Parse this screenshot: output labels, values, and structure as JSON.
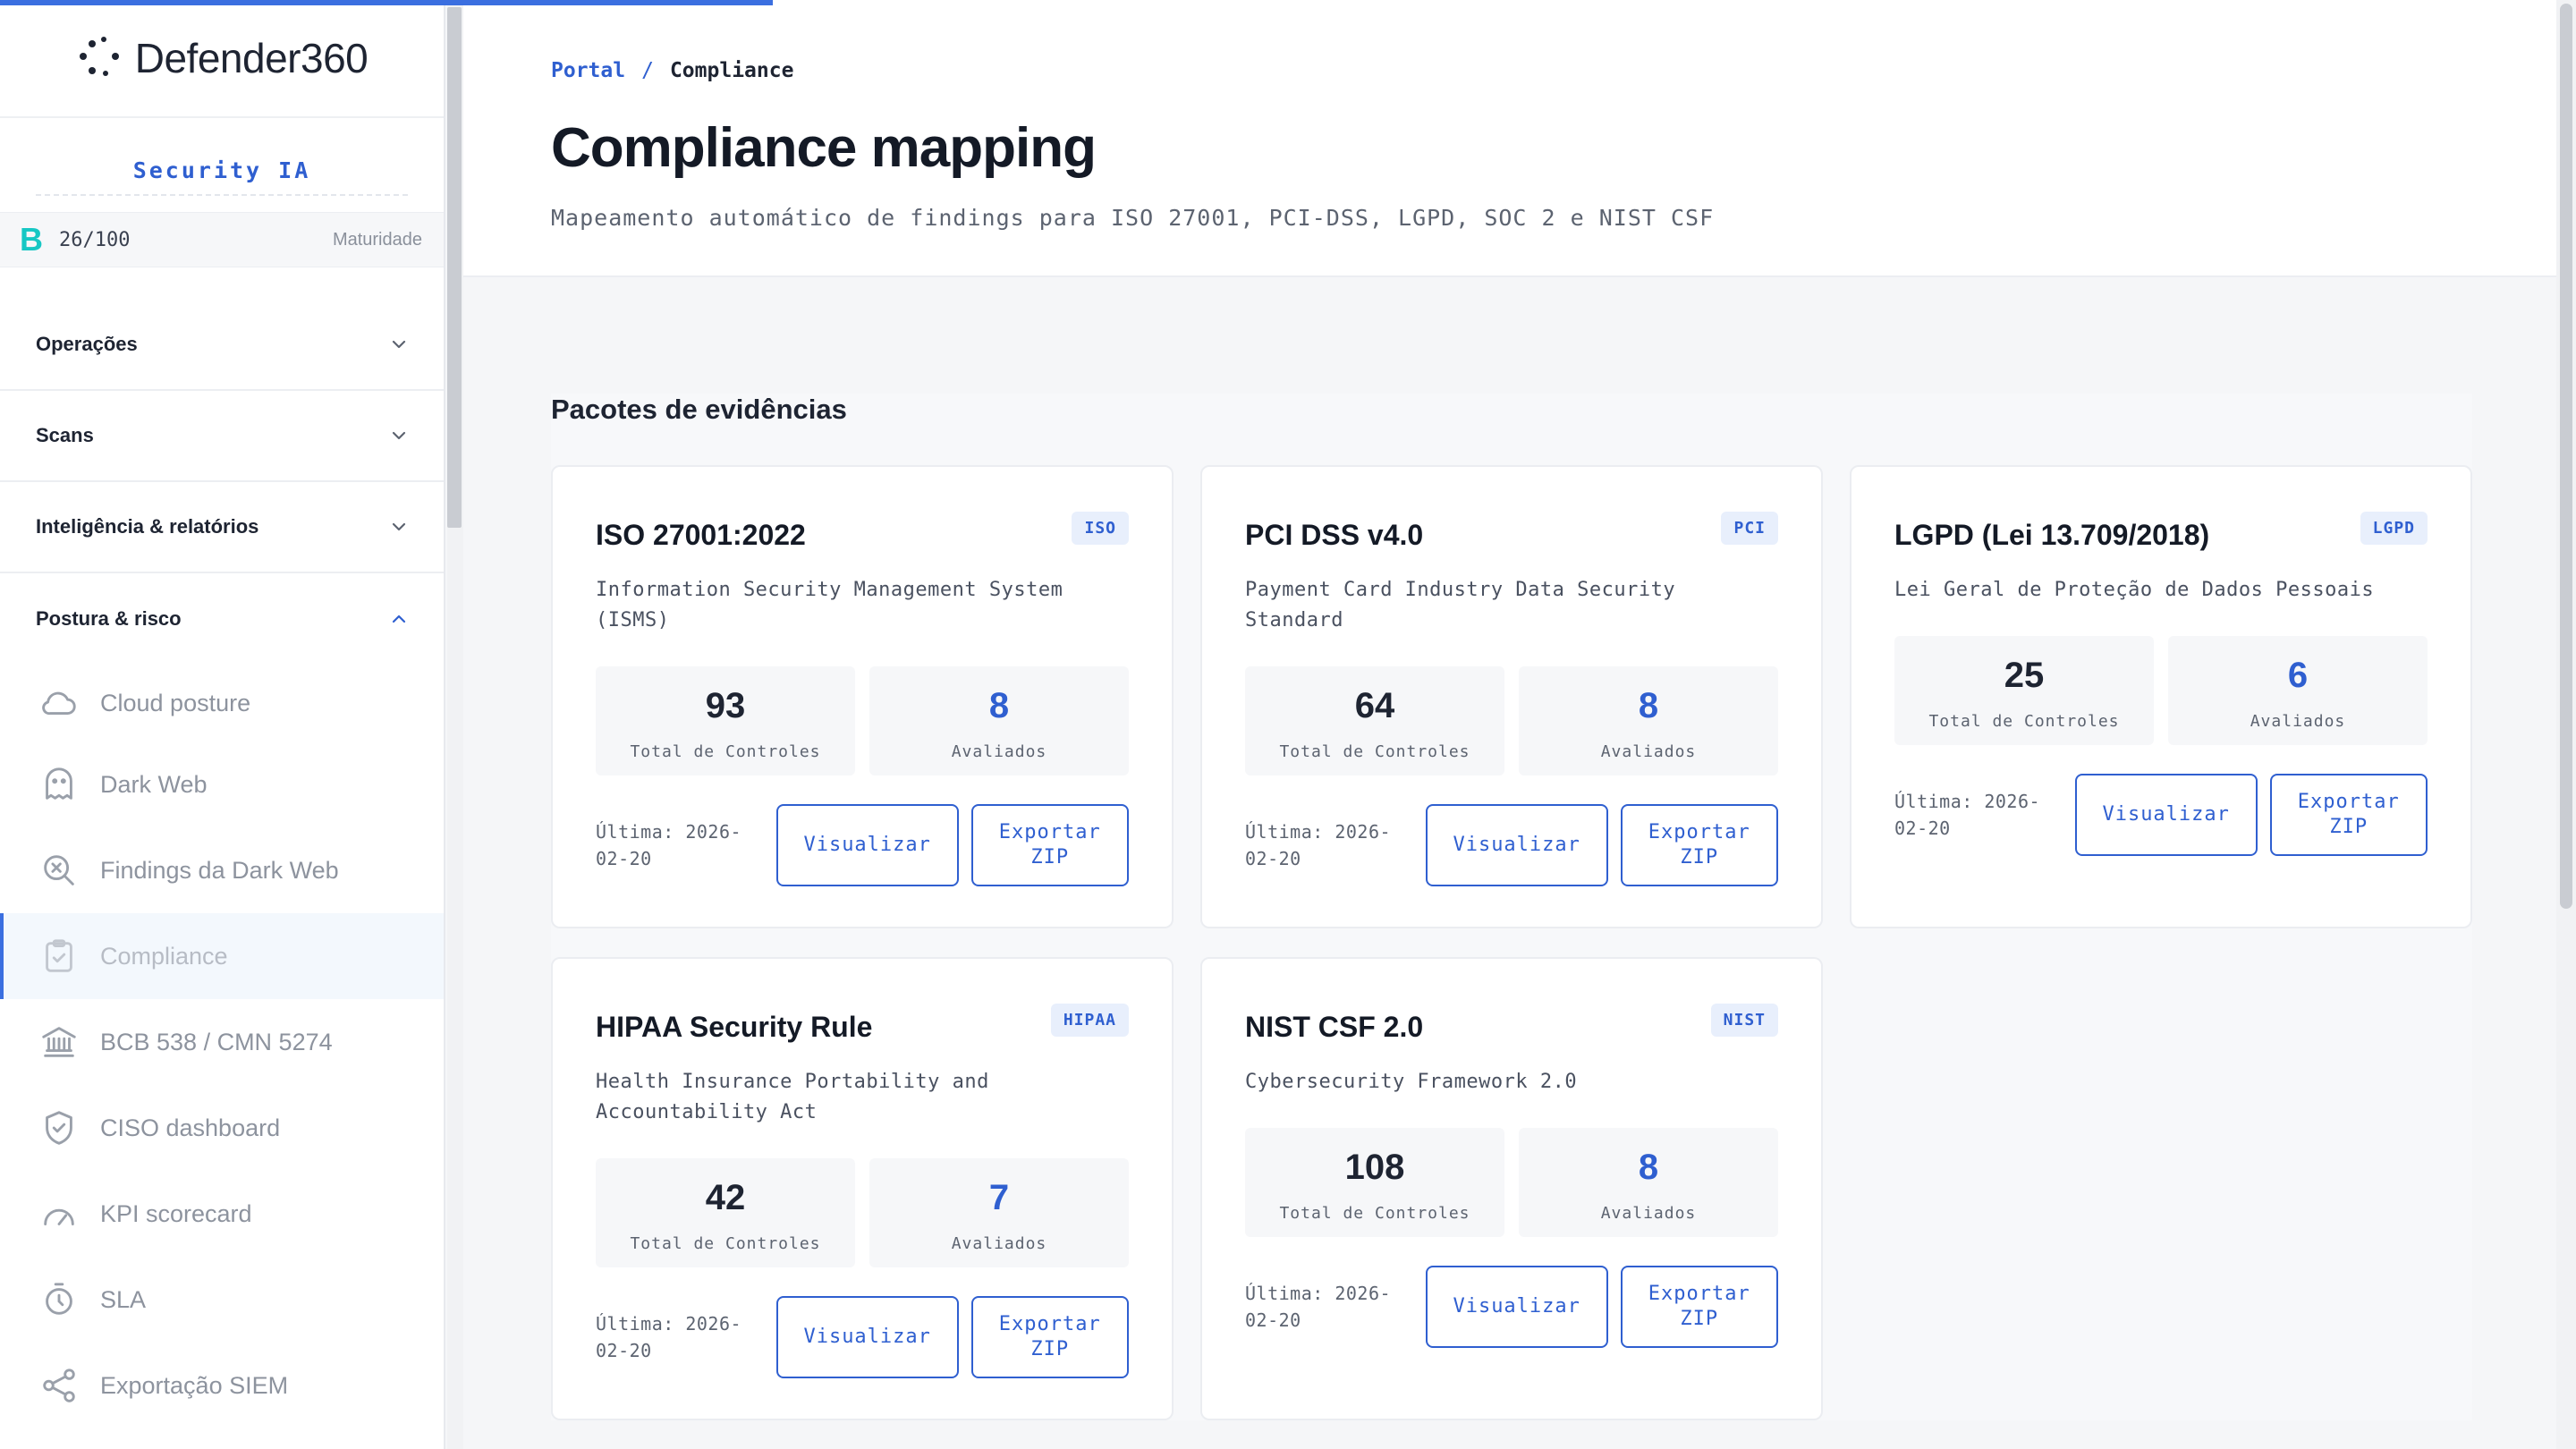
{
  "app": {
    "brand": "Defender360",
    "progress_percent": 30
  },
  "sidebar": {
    "security_ia": "Security IA",
    "maturity": {
      "grade": "B",
      "score": "26/100",
      "label": "Maturidade"
    },
    "groups": [
      {
        "label": "Operações",
        "icon": "chevron-down-icon"
      },
      {
        "label": "Scans",
        "icon": "chevron-down-icon"
      },
      {
        "label": "Inteligência & relatórios",
        "icon": "chevron-down-icon"
      },
      {
        "label": "Postura & risco",
        "icon": "chevron-up-icon"
      }
    ],
    "items": [
      {
        "label": "Cloud posture",
        "icon": "cloud-icon"
      },
      {
        "label": "Dark Web",
        "icon": "ghost-icon"
      },
      {
        "label": "Findings da Dark Web",
        "icon": "search-x-icon"
      },
      {
        "label": "Compliance",
        "icon": "clipboard-check-icon"
      },
      {
        "label": "BCB 538 / CMN 5274",
        "icon": "bank-icon"
      },
      {
        "label": "CISO dashboard",
        "icon": "shield-check-icon"
      },
      {
        "label": "KPI scorecard",
        "icon": "gauge-icon"
      },
      {
        "label": "SLA",
        "icon": "timer-icon"
      },
      {
        "label": "Exportação SIEM",
        "icon": "share-icon"
      }
    ]
  },
  "header": {
    "breadcrumb": {
      "parent": "Portal",
      "separator": "/",
      "current": "Compliance"
    },
    "title": "Compliance mapping",
    "subtitle": "Mapeamento automático de findings para ISO 27001, PCI-DSS, LGPD, SOC 2 e NIST CSF"
  },
  "section": {
    "title": "Pacotes de evidências",
    "total_label": "Total de Controles",
    "evaluated_label": "Avaliados",
    "view_label": "Visualizar",
    "export_label": "Exportar ZIP",
    "cards": [
      {
        "title": "ISO 27001:2022",
        "badge": "ISO",
        "description": "Information Security Management System (ISMS)",
        "total": "93",
        "evaluated": "8",
        "last": "Última: 2026-02-20"
      },
      {
        "title": "PCI DSS v4.0",
        "badge": "PCI",
        "description": "Payment Card Industry Data Security Standard",
        "total": "64",
        "evaluated": "8",
        "last": "Última: 2026-02-20"
      },
      {
        "title": "LGPD (Lei 13.709/2018)",
        "badge": "LGPD",
        "description": "Lei Geral de Proteção de Dados Pessoais",
        "total": "25",
        "evaluated": "6",
        "last": "Última: 2026-02-20"
      },
      {
        "title": "HIPAA Security Rule",
        "badge": "HIPAA",
        "description": "Health Insurance Portability and Accountability Act",
        "total": "42",
        "evaluated": "7",
        "last": "Última: 2026-02-20"
      },
      {
        "title": "NIST CSF 2.0",
        "badge": "NIST",
        "description": "Cybersecurity Framework 2.0",
        "total": "108",
        "evaluated": "8",
        "last": "Última: 2026-02-20"
      }
    ]
  },
  "colors": {
    "accent": "#2f5fd0",
    "progress": "#3b6fe0",
    "grade": "#16c7c4"
  }
}
